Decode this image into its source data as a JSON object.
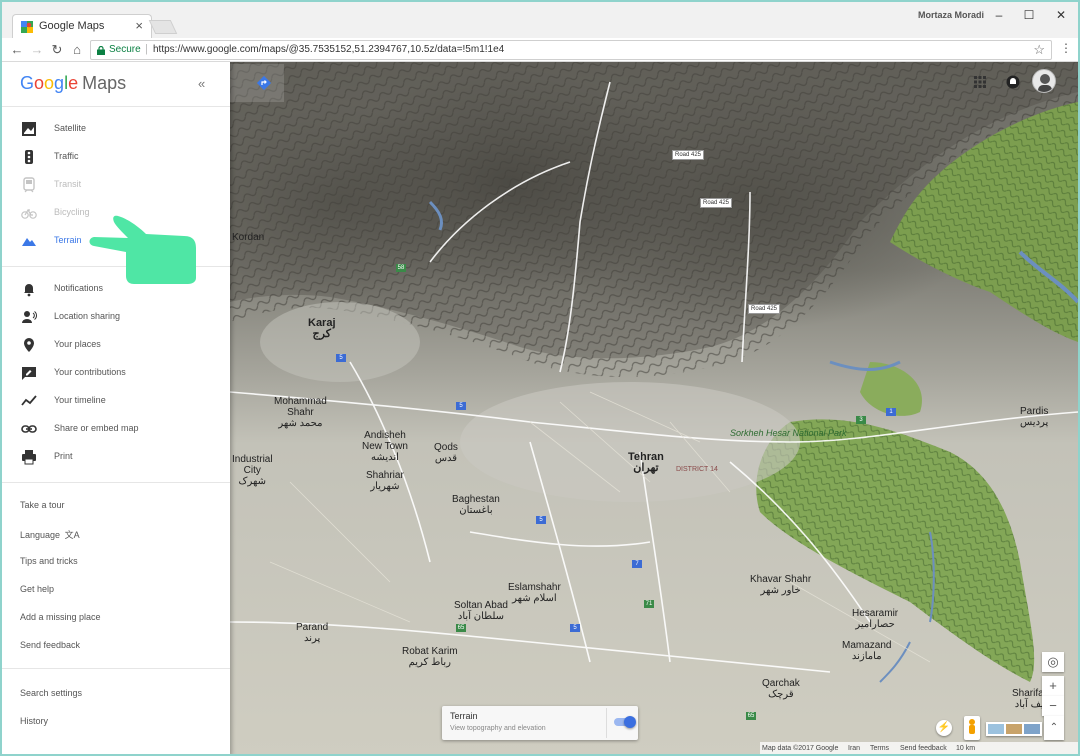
{
  "browser": {
    "tab_title": "Google Maps",
    "profile_name": "Mortaza Moradi",
    "window_controls": [
      "–",
      "☐",
      "✕"
    ],
    "nav": {
      "back_icon": "back-arrow-icon",
      "forward_icon": "forward-arrow-icon",
      "reload_icon": "reload-icon",
      "home_icon": "home-icon"
    },
    "secure_label": "Secure",
    "url": "https://www.google.com/maps/@35.7535152,51.2394767,10.5z/data=!5m1!1e4"
  },
  "sidebar": {
    "brand_google": [
      "G",
      "o",
      "o",
      "g",
      "l",
      "e"
    ],
    "brand_maps": "Maps",
    "collapse_glyph": "«",
    "layers": [
      {
        "label": "Satellite",
        "icon": "satellite-icon",
        "state": "normal"
      },
      {
        "label": "Traffic",
        "icon": "traffic-icon",
        "state": "normal"
      },
      {
        "label": "Transit",
        "icon": "transit-icon",
        "state": "disabled"
      },
      {
        "label": "Bicycling",
        "icon": "bicycle-icon",
        "state": "disabled"
      },
      {
        "label": "Terrain",
        "icon": "terrain-icon",
        "state": "active"
      }
    ],
    "actions": [
      {
        "label": "Notifications",
        "icon": "bell-icon"
      },
      {
        "label": "Location sharing",
        "icon": "location-sharing-icon"
      },
      {
        "label": "Your places",
        "icon": "pin-icon"
      },
      {
        "label": "Your contributions",
        "icon": "contributions-icon"
      },
      {
        "label": "Your timeline",
        "icon": "timeline-icon"
      },
      {
        "label": "Share or embed map",
        "icon": "link-icon"
      },
      {
        "label": "Print",
        "icon": "print-icon"
      }
    ],
    "help_links": [
      "Take a tour",
      "Language",
      "Tips and tricks",
      "Get help",
      "Add a missing place",
      "Send feedback"
    ],
    "settings_links": [
      "Search settings",
      "History"
    ]
  },
  "map": {
    "cities": [
      {
        "name": "Karaj\nکرج",
        "big": true
      },
      {
        "name": "Tehran\nتهران",
        "big": true
      },
      {
        "name": "Mohammad\nShahr\nمحمد شهر",
        "big": false
      },
      {
        "name": "Andisheh\nNew Town\nاندیشه",
        "big": false
      },
      {
        "name": "Qods\nقدس",
        "big": false
      },
      {
        "name": "Shahriar\nشهریار",
        "big": false
      },
      {
        "name": "Baghestan\nباغستان",
        "big": false
      },
      {
        "name": "Eslamshahr\nاسلام شهر",
        "big": false
      },
      {
        "name": "Soltan Abad\nسلطان آباد",
        "big": false
      },
      {
        "name": "Parand\nپرند",
        "big": false
      },
      {
        "name": "Robat Karim\nرباط کریم",
        "big": false
      },
      {
        "name": "Qarchak\nقرچک",
        "big": false
      },
      {
        "name": "Mamazand\nمامازند",
        "big": false
      },
      {
        "name": "Khavar Shahr\nخاور شهر",
        "big": false
      },
      {
        "name": "Hesaramir\nحصارامیر",
        "big": false
      },
      {
        "name": "Sharifabad\nشریف آباد",
        "big": false
      },
      {
        "name": "Pardis\nپردیس",
        "big": false
      },
      {
        "name": "Kordan",
        "big": false
      },
      {
        "name": "Industrial\nCity\nشهرک",
        "big": false
      }
    ],
    "park_label": "Sorkheh Hesar\nNational Park",
    "district_label": "DISTRICT 14",
    "road_shields": [
      "Road 425",
      "Road 425",
      "Road 425"
    ],
    "num_shields": [
      "58",
      "5",
      "5",
      "7",
      "71",
      "65",
      "5",
      "65",
      "5",
      "3",
      "1"
    ],
    "terrain_card": {
      "title": "Terrain",
      "subtitle": "View topography and elevation",
      "enabled": true
    },
    "controls": {
      "locate": "◎",
      "zoom_in": "+",
      "zoom_out": "−",
      "expand": "⌃"
    },
    "footer": [
      "Map data ©2017 Google",
      "Iran",
      "Terms",
      "Send feedback",
      "10 km"
    ]
  },
  "colors": {
    "accent": "#3b78e7",
    "pointer_hand": "#4fe6a5",
    "terrain_green": "#86a65a"
  }
}
